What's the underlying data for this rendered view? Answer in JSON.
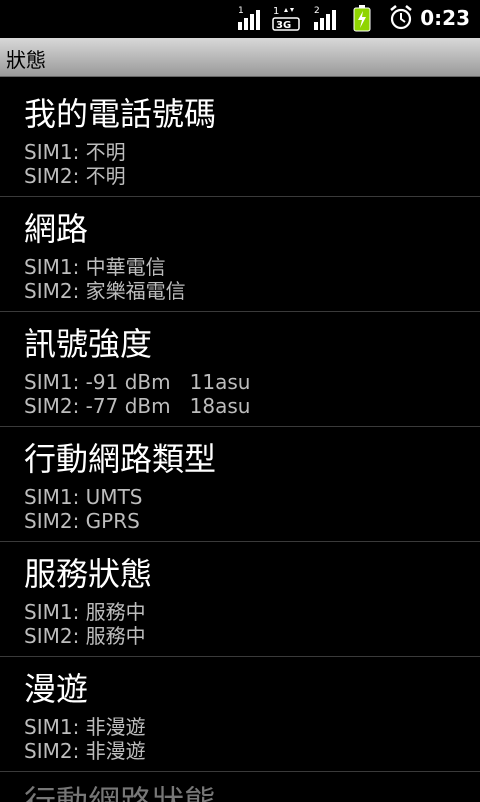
{
  "status_bar": {
    "sim1_signal_label": "1",
    "network_type": "3G",
    "sim2_signal_label": "2",
    "time": "0:23",
    "icons": [
      "sim1-signal-icon",
      "3g-data-icon",
      "sim2-signal-icon",
      "battery-charging-icon",
      "alarm-icon"
    ]
  },
  "title_bar": {
    "title": "狀態"
  },
  "list": {
    "items": [
      {
        "title": "我的電話號碼",
        "line1": "SIM1: 不明",
        "line2": "SIM2: 不明"
      },
      {
        "title": "網路",
        "line1": "SIM1: 中華電信",
        "line2": "SIM2: 家樂福電信"
      },
      {
        "title": "訊號強度",
        "line1": "SIM1: -91 dBm   11asu",
        "line2": "SIM2: -77 dBm   18asu"
      },
      {
        "title": "行動網路類型",
        "line1": "SIM1: UMTS",
        "line2": "SIM2: GPRS"
      },
      {
        "title": "服務狀態",
        "line1": "SIM1: 服務中",
        "line2": "SIM2: 服務中"
      },
      {
        "title": "漫遊",
        "line1": "SIM1: 非漫遊",
        "line2": "SIM2: 非漫遊"
      }
    ],
    "partial_item_title": "行動網路狀態"
  },
  "colors": {
    "background": "#000000",
    "battery": "#8fd500"
  }
}
